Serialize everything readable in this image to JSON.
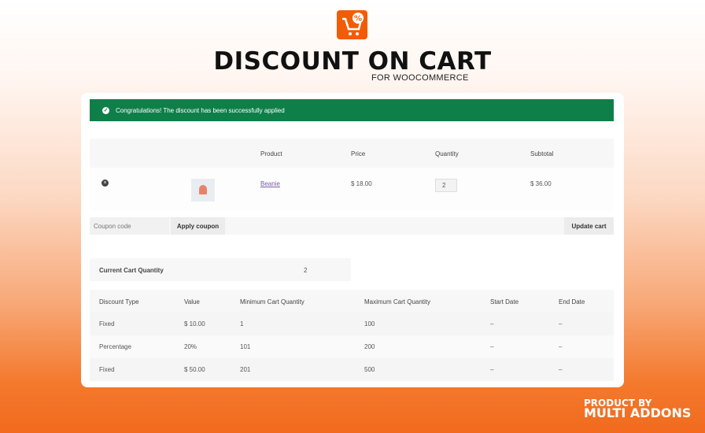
{
  "header": {
    "title": "DISCOUNT ON CART",
    "subtitle": "FOR WOOCOMMERCE"
  },
  "notice": {
    "text": "Congratulations! The discount has been successfully applied"
  },
  "cart": {
    "headers": [
      "Product",
      "Price",
      "Quantity",
      "Subtotal"
    ],
    "row": {
      "product": "Beanie",
      "price": "$ 18.00",
      "quantity": "2",
      "subtotal": "$ 36.00"
    }
  },
  "coupon": {
    "placeholder": "Coupon code",
    "apply": "Apply coupon",
    "update": "Update cart"
  },
  "summary": {
    "label": "Current Cart Quantity",
    "value": "2"
  },
  "discounts": {
    "headers": [
      "Discount Type",
      "Value",
      "Minimum Cart Quantity",
      "Maximum Cart Quantity",
      "Start Date",
      "End Date"
    ],
    "rows": [
      [
        "Fixed",
        "$ 10.00",
        "1",
        "100",
        "–",
        "–"
      ],
      [
        "Percentage",
        "20%",
        "101",
        "200",
        "–",
        "–"
      ],
      [
        "Fixed",
        "$ 50.00",
        "201",
        "500",
        "–",
        "–"
      ]
    ]
  },
  "footer": {
    "line1": "PRODUCT BY",
    "line2": "MULTI ADDONS"
  }
}
